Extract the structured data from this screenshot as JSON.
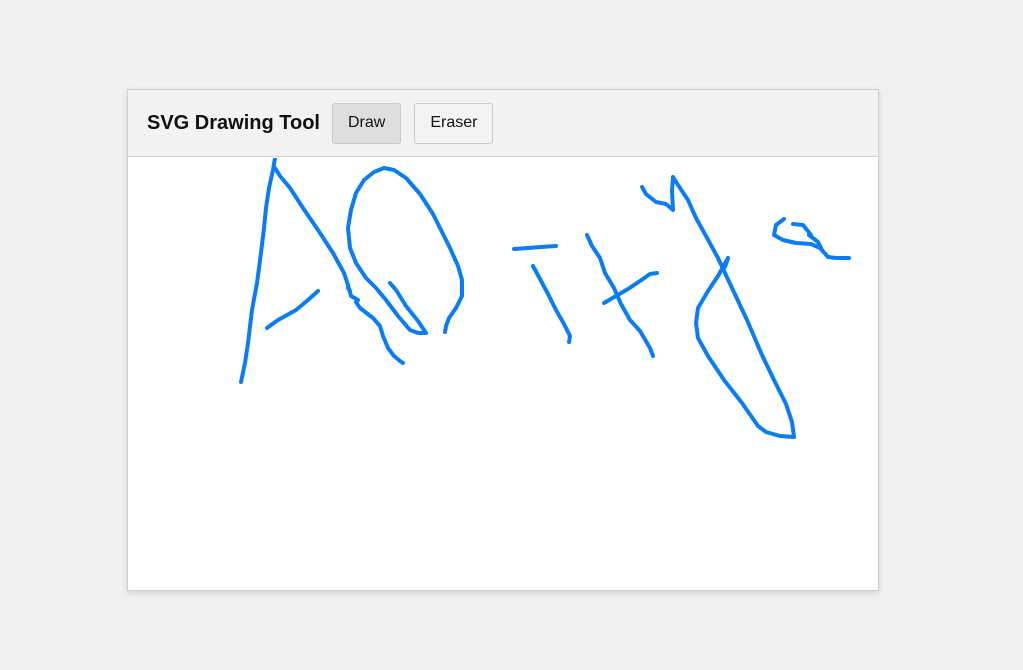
{
  "toolbar": {
    "title": "SVG Drawing Tool",
    "draw_label": "Draw",
    "eraser_label": "Eraser",
    "active_tool": "draw"
  },
  "canvas": {
    "stroke_color": "#0a7cf5",
    "strokes": [
      {
        "name": "stroke-a-left"
      },
      {
        "name": "stroke-a-right"
      },
      {
        "name": "stroke-a-crossbar"
      },
      {
        "name": "stroke-o-loop"
      },
      {
        "name": "stroke-o-tail"
      },
      {
        "name": "stroke-o-end"
      },
      {
        "name": "stroke-t-bar"
      },
      {
        "name": "stroke-t-stem"
      },
      {
        "name": "stroke-f-stem"
      },
      {
        "name": "stroke-f-cross"
      },
      {
        "name": "stroke-loop-top"
      },
      {
        "name": "stroke-loop-body"
      },
      {
        "name": "stroke-small-squiggle"
      }
    ]
  }
}
